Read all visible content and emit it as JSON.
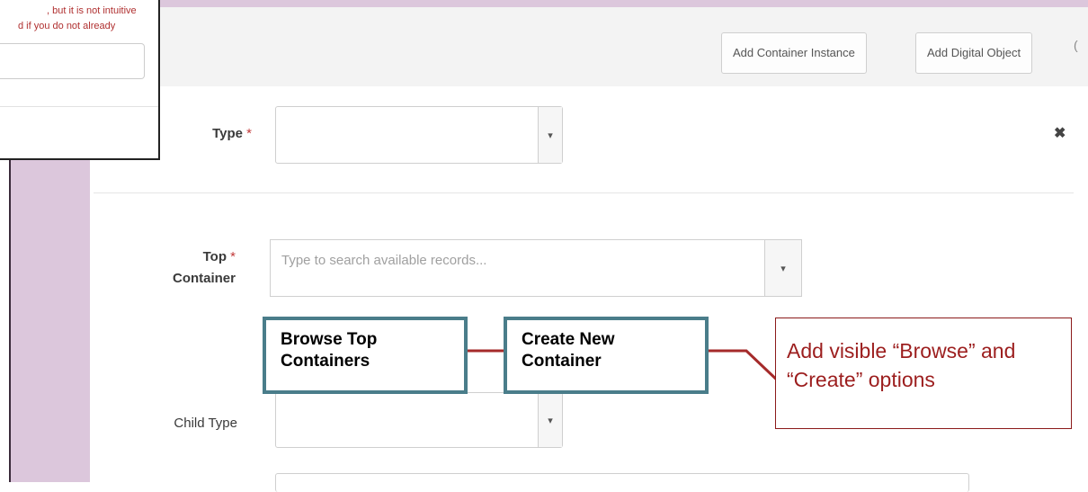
{
  "inset": {
    "line1": ", but it is not intuitive",
    "line2": "d if you do not already"
  },
  "toolbar": {
    "add_container_instance": "Add Container Instance",
    "add_digital_object": "Add Digital Object"
  },
  "form": {
    "type_label": "Type",
    "required_mark": "*",
    "top_container_label_1": "Top",
    "top_container_label_2": "Container",
    "top_container_placeholder": "Type to search available records...",
    "child_type_label": "Child Type"
  },
  "callouts": {
    "browse": "Browse Top Containers",
    "create": "Create New Container",
    "note": "Add visible “Browse” and “Create” options"
  },
  "colors": {
    "accent_teal": "#4a7d8a",
    "annotation_red": "#9c1e1e",
    "purple_band": "#dcc7dc"
  }
}
